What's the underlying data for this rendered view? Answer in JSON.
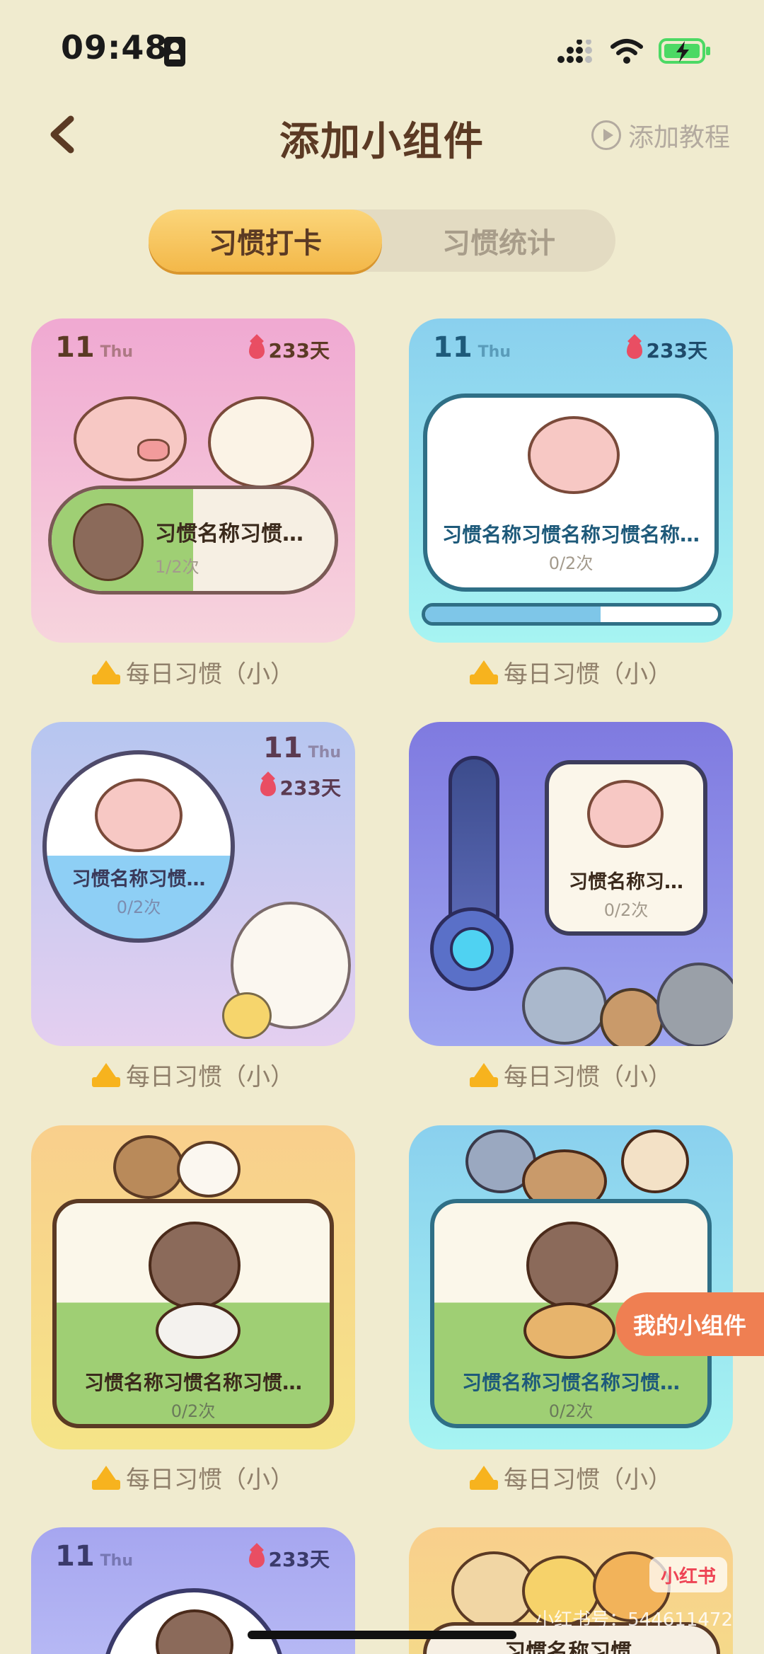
{
  "status_bar": {
    "time": "09:48"
  },
  "header": {
    "title": "添加小组件",
    "tutorial_label": "添加教程"
  },
  "tabs": [
    {
      "label": "习惯打卡",
      "active": true
    },
    {
      "label": "习惯统计",
      "active": false
    }
  ],
  "cards": [
    {
      "day": "11",
      "dow": "Thu",
      "streak": "233天",
      "habit_name": "习惯名称习惯…",
      "count": "1/2次",
      "caption": "每日习惯（小）",
      "progress": 0.5
    },
    {
      "day": "11",
      "dow": "Thu",
      "streak": "233天",
      "habit_name": "习惯名称习惯名称习惯名称…",
      "count": "0/2次",
      "caption": "每日习惯（小）",
      "progress": 0.6
    },
    {
      "day": "11",
      "dow": "Thu",
      "streak": "233天",
      "habit_name": "习惯名称习惯…",
      "count": "0/2次",
      "caption": "每日习惯（小）"
    },
    {
      "habit_name": "习惯名称习…",
      "count": "0/2次",
      "caption": "每日习惯（小）"
    },
    {
      "habit_name": "习惯名称习惯名称习惯…",
      "count": "0/2次",
      "caption": "每日习惯（小）"
    },
    {
      "habit_name": "习惯名称习惯名称习惯…",
      "count": "0/2次",
      "caption": "每日习惯（小）"
    },
    {
      "day": "11",
      "dow": "Thu",
      "streak": "233天"
    },
    {
      "habit_name": "习惯名称习惯…"
    }
  ],
  "floating_button": "我的小组件",
  "watermark": {
    "logo": "小红书",
    "text": "小红书号：544611472"
  },
  "colors": {
    "background": "#f0ebcf",
    "accent": "#f3b849",
    "text_brown": "#5b3a24"
  }
}
